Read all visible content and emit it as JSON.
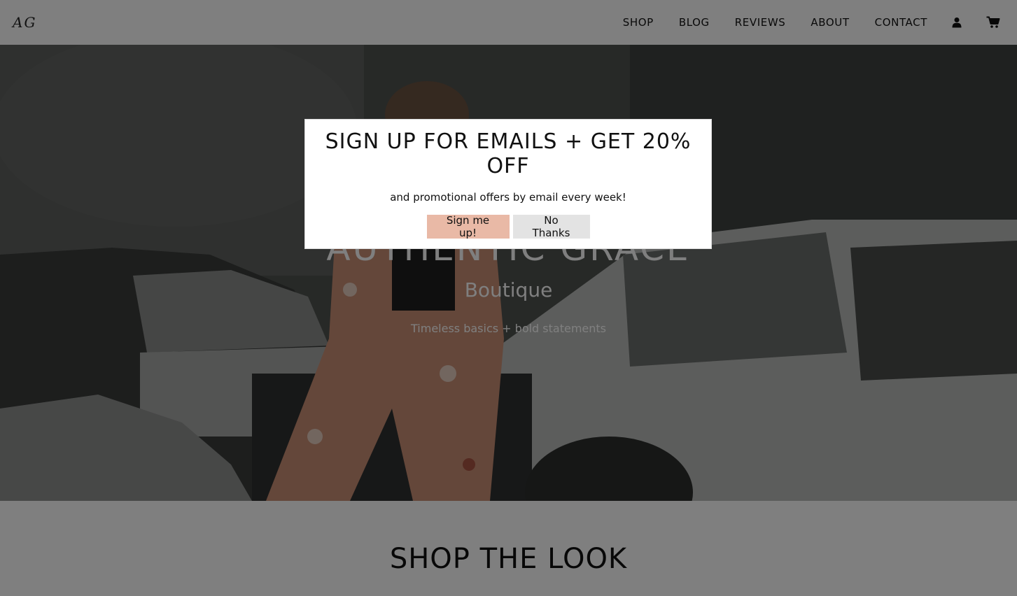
{
  "header": {
    "logo": "AG",
    "nav": [
      "SHOP",
      "BLOG",
      "REVIEWS",
      "ABOUT",
      "CONTACT"
    ],
    "icons": [
      "user-icon",
      "cart-icon"
    ]
  },
  "hero": {
    "title": "AUTHENTIC GRACE",
    "subtitle": "Boutique",
    "tagline": "Timeless basics + bold statements"
  },
  "section": {
    "title": "SHOP THE LOOK"
  },
  "modal": {
    "title": "SIGN UP FOR EMAILS + GET 20% OFF",
    "text": "and promotional offers by email every week!",
    "primary_button": "Sign me up!",
    "secondary_button": "No Thanks"
  },
  "colors": {
    "accent": "#e9b9a6",
    "secondary_button": "#e3e3e3",
    "overlay": "rgba(0,0,0,0.5)"
  }
}
